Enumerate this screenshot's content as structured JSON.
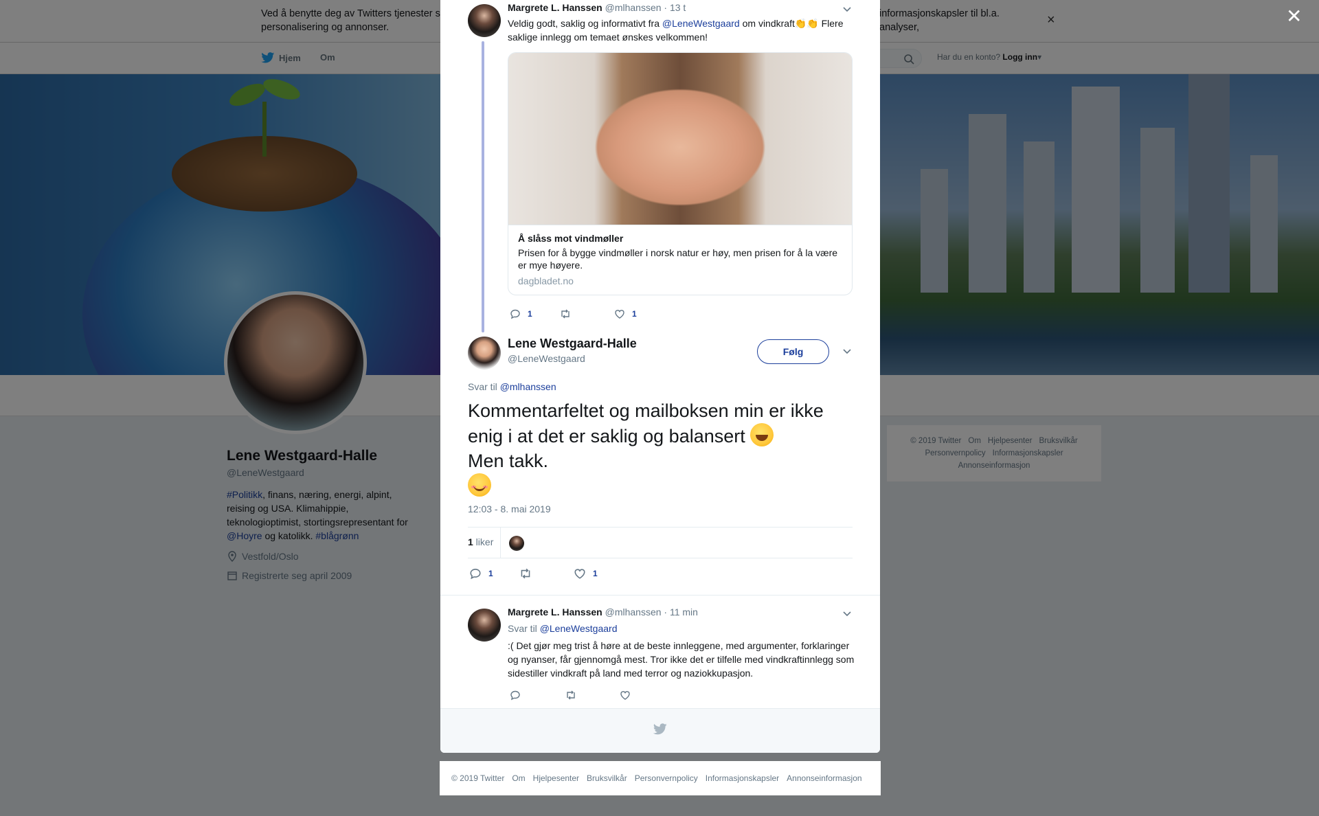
{
  "background": {
    "cookie_text": "Ved å benytte deg av Twitters tjenester sa",
    "cookie_text_right": "informasjonskapsler til bl.a. analyser,",
    "cookie_text_line2": "personalisering og annonser.",
    "nav": {
      "home": "Hjem",
      "about": "Om",
      "account_prompt": "Har du en konto?",
      "login": "Logg inn"
    },
    "profile": {
      "name": "Lene Westgaard-Halle",
      "handle": "@LeneWestgaard",
      "bio_tag": "#Politikk",
      "bio_text": ", finans, næring, energi, alpint, reising og USA. Klimahippie, teknologioptimist, stortingsrepresentant for ",
      "bio_mention": "@Hoyre",
      "bio_text2": " og katolikk. ",
      "bio_tag2": "#blågrønn",
      "location": "Vestfold/Oslo",
      "joined": "Registrerte seg april 2009"
    },
    "side_footer": [
      "© 2019 Twitter",
      "Om",
      "Hjelpesenter",
      "Bruksvilkår",
      "Personvernpolicy",
      "Informasjonskapsler",
      "Annonseinformasjon"
    ]
  },
  "modal": {
    "parent_tweet": {
      "author": "Margrete L. Hanssen",
      "handle": "@mlhanssen",
      "time": "· 13 t",
      "text_before": "Veldig godt, saklig og informativt fra ",
      "mention": "@LeneWestgaard",
      "text_after": " om vindkraft👏👏 Flere saklige innlegg om temaet ønskes velkommen!",
      "card": {
        "title": "Å slåss mot vindmøller",
        "description": "Prisen for å bygge vindmøller i norsk natur er høy, men prisen for å la være er mye høyere.",
        "domain": "dagbladet.no"
      },
      "replies": "1",
      "likes": "1"
    },
    "main_tweet": {
      "author": "Lene Westgaard-Halle",
      "handle": "@LeneWestgaard",
      "follow_label": "Følg",
      "reply_prefix": "Svar til ",
      "reply_to": "@mlhanssen",
      "text_line1": "Kommentarfeltet og mailboksen min er ikke enig i at det er saklig og balansert ",
      "text_line2": "Men takk.",
      "timestamp": "12:03 - 8. mai 2019",
      "likes_count": "1",
      "likes_label": " liker",
      "replies": "1",
      "likes": "1"
    },
    "reply_tweet": {
      "author": "Margrete L. Hanssen",
      "handle": "@mlhanssen",
      "time": "· 11 min",
      "reply_prefix": "Svar til ",
      "reply_to": "@LeneWestgaard",
      "text": ":( Det gjør meg trist å høre at de beste innleggene, med argumenter, forklaringer og nyanser, får gjennomgå mest. Tror ikke det er tilfelle med vindkraftinnlegg som sidestiller vindkraft på land med terror og naziokkupasjon."
    }
  },
  "footer": [
    "© 2019 Twitter",
    "Om",
    "Hjelpesenter",
    "Bruksvilkår",
    "Personvernpolicy",
    "Informasjonskapsler",
    "Annonseinformasjon"
  ],
  "colors": {
    "link": "#1b3e9b",
    "muted": "#657786",
    "overlay": "rgba(0,0,0,0.5)"
  },
  "icons": [
    "twitter-bird-icon",
    "search-icon",
    "close-icon",
    "caret-down-icon",
    "reply-icon",
    "retweet-icon",
    "heart-icon",
    "location-icon",
    "calendar-icon"
  ]
}
